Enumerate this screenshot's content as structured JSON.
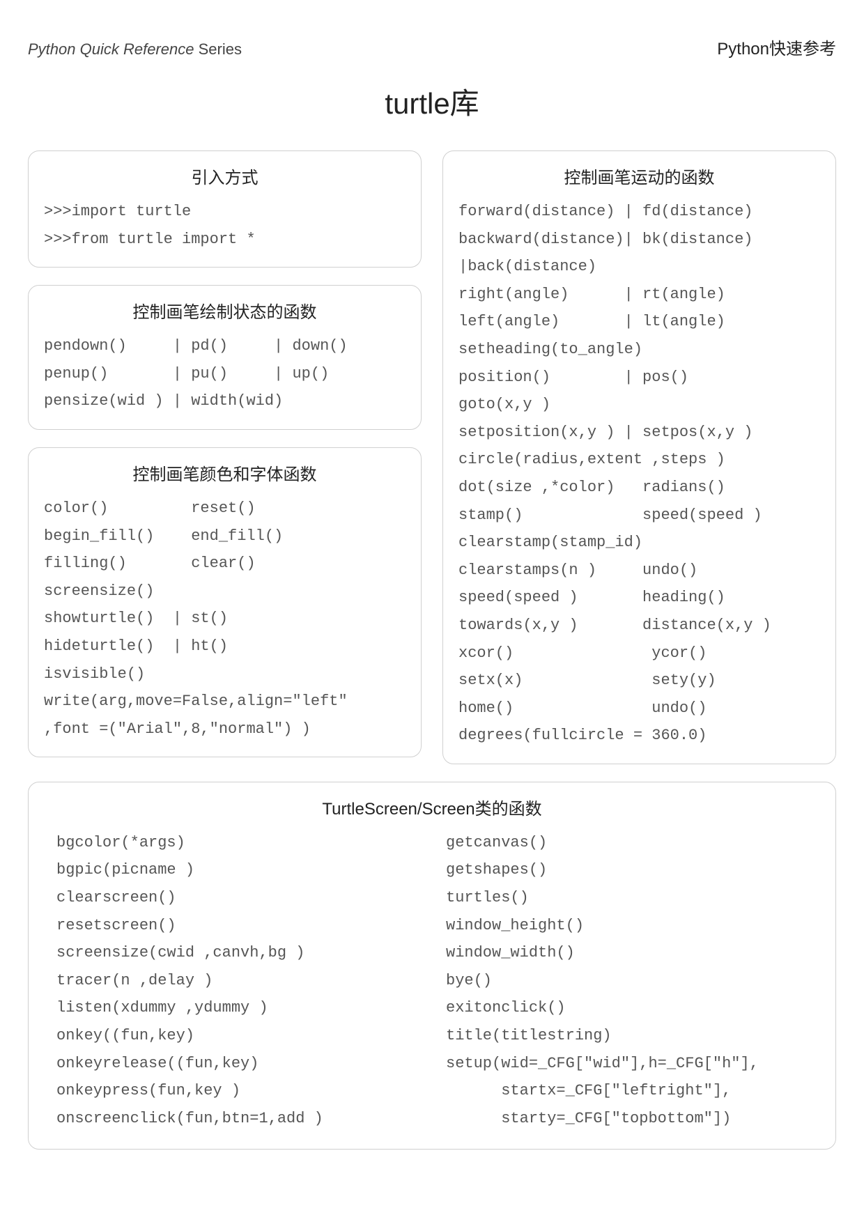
{
  "header": {
    "left_italic": "Python Quick Reference",
    "left_rest": " Series",
    "right": "Python快速参考"
  },
  "title": "turtle库",
  "boxes": {
    "import": {
      "title": "引入方式",
      "body": ">>>import turtle\n>>>from turtle import *"
    },
    "pen_state": {
      "title": "控制画笔绘制状态的函数",
      "body": "pendown()     | pd()     | down()\npenup()       | pu()     | up()\npensize(wid ) | width(wid)"
    },
    "color_font": {
      "title": "控制画笔颜色和字体函数",
      "body": "color()         reset()\nbegin_fill()    end_fill()\nfilling()       clear()\nscreensize()\nshowturtle()  | st()\nhideturtle()  | ht()\nisvisible()\nwrite(arg,move=False,align=\"left\"\n,font =(\"Arial\",8,\"normal\") )"
    },
    "motion": {
      "title": "控制画笔运动的函数",
      "body": "forward(distance) | fd(distance)\nbackward(distance)| bk(distance)\n|back(distance)\nright(angle)      | rt(angle)\nleft(angle)       | lt(angle)\nsetheading(to_angle)\nposition()        | pos()\ngoto(x,y )\nsetposition(x,y ) | setpos(x,y )\ncircle(radius,extent ,steps )\ndot(size ,*color)   radians()\nstamp()             speed(speed )\nclearstamp(stamp_id)\nclearstamps(n )     undo()\nspeed(speed )       heading()\ntowards(x,y )       distance(x,y )\nxcor()               ycor()\nsetx(x)              sety(y)\nhome()               undo()\ndegrees(fullcircle = 360.0)"
    },
    "screen": {
      "title": "TurtleScreen/Screen类的函数",
      "left": "bgcolor(*args)\nbgpic(picname )\nclearscreen()\nresetscreen()\nscreensize(cwid ,canvh,bg )\ntracer(n ,delay )\nlisten(xdummy ,ydummy )\nonkey((fun,key)\nonkeyrelease((fun,key)\nonkeypress(fun,key )\nonscreenclick(fun,btn=1,add )",
      "right": "getcanvas()\ngetshapes()\nturtles()\nwindow_height()\nwindow_width()\nbye()\nexitonclick()\ntitle(titlestring)\nsetup(wid=_CFG[\"wid\"],h=_CFG[\"h\"],\n      startx=_CFG[\"leftright\"],\n      starty=_CFG[\"topbottom\"])"
    }
  }
}
